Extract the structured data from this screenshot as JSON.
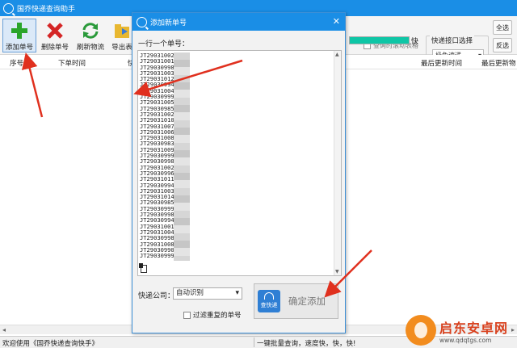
{
  "main_window": {
    "title": "国乔快递查询助手",
    "toolbar": {
      "add_label": "添加单号",
      "delete_label": "删除单号",
      "refresh_label": "刷新物流",
      "export_label": "导出表"
    },
    "scroll_option": "查询时滚动表格",
    "speed_label": "快",
    "interface": {
      "title": "快递接口选择",
      "selected": "极兔速递"
    },
    "side_buttons": [
      "全选",
      "反选"
    ],
    "columns": [
      "序号",
      "下单时间",
      "快",
      "最后更新时间",
      "最后更新物"
    ],
    "status_left": "欢迎使用《国乔快递查询快手》",
    "status_right": "一键批量查询，速度快，快，快!"
  },
  "dialog": {
    "title": "添加新单号",
    "hint": "一行一个单号：",
    "tracking_lines": [
      "JT29031002",
      "JT29031001",
      "JT29030998",
      "JT29031003",
      "JT29031012",
      "JT29030994",
      "JT29031004",
      "JT29030999",
      "JT29031005",
      "JT29030985",
      "JT29031002",
      "JT29031010",
      "JT29031007",
      "JT29031006",
      "JT29031008",
      "JT29030983",
      "JT29031009",
      "JT29030999",
      "JT29030998",
      "JT29031002",
      "JT29030996",
      "JT29031011",
      "JT29030994",
      "JT29031003",
      "JT29031014",
      "JT29030985",
      "JT29030999",
      "JT29030998",
      "JT29030994",
      "JT29031001",
      "JT29031004",
      "JT29030998",
      "JT29031008",
      "JT29030990",
      "JT29030999"
    ],
    "company_label": "快递公司：",
    "company_selected": "自动识别",
    "filter_label": "过滤重复的单号",
    "badge_text": "查快递",
    "confirm_label": "确定添加"
  },
  "watermark": {
    "name": "启东安卓网",
    "url": "www.qdqtgs.com"
  },
  "colors": {
    "title_bar": "#1a8ee6",
    "progress": "#0ec6a6",
    "arrow": "#e0301e"
  }
}
